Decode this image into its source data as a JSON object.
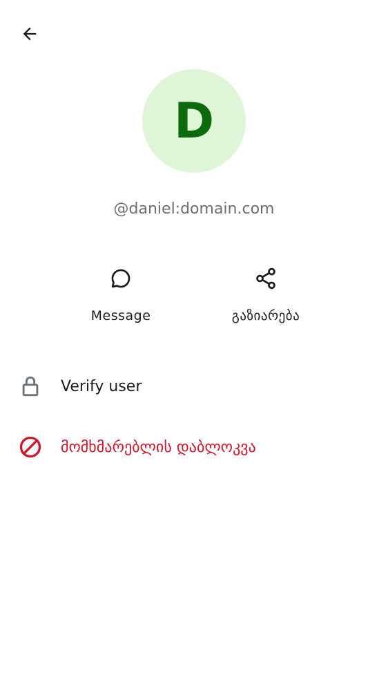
{
  "header": {
    "back_icon": "arrow-back-icon"
  },
  "profile": {
    "avatar_letter": "D",
    "avatar_bg": "#dff5d8",
    "avatar_fg": "#0b6a0b",
    "user_id": "@daniel:domain.com"
  },
  "actions": [
    {
      "label": "Message",
      "icon": "chat-bubble-icon"
    },
    {
      "label": "გაზიარება",
      "icon": "share-icon"
    }
  ],
  "list": [
    {
      "label": "Verify user",
      "icon": "lock-icon",
      "color": "#1b1b1f"
    },
    {
      "label": "მომხმარებლის დაბლოკვა",
      "icon": "block-icon",
      "color": "#d1162b"
    }
  ]
}
